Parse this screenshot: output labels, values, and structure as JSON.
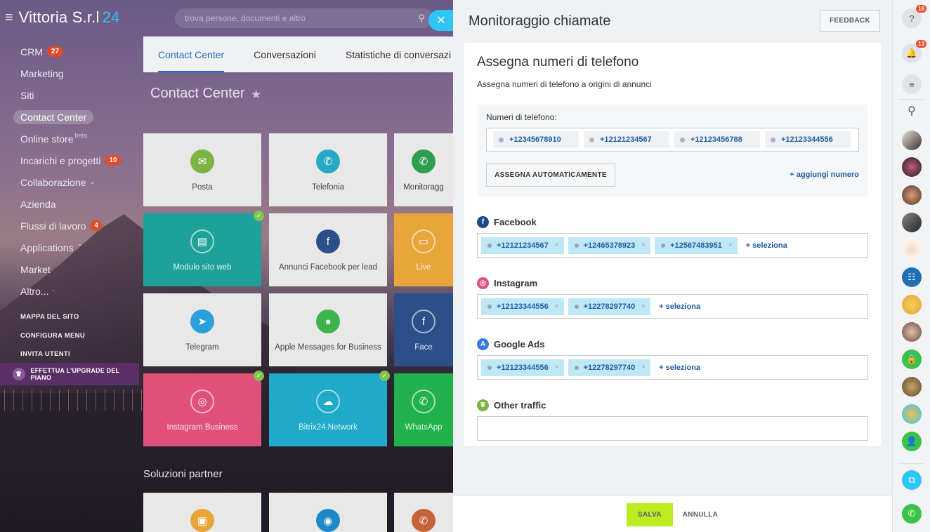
{
  "app": {
    "logo": "Vittoria S.r.l",
    "logo_num": "24",
    "search_placeholder": "trova persone, documenti e altro"
  },
  "menu": {
    "items": [
      {
        "label": "CRM",
        "badge": "27"
      },
      {
        "label": "Marketing"
      },
      {
        "label": "Siti"
      },
      {
        "label": "Contact Center",
        "active": true
      },
      {
        "label": "Online store",
        "sup": "beta"
      },
      {
        "label": "Incarichi e progetti",
        "badge": "10"
      },
      {
        "label": "Collaborazione",
        "chevron": "down"
      },
      {
        "label": "Azienda"
      },
      {
        "label": "Flussi di lavoro",
        "badge": "4"
      },
      {
        "label": "Applications",
        "chevron": "up"
      },
      {
        "label": "Market"
      },
      {
        "label": "Altro...",
        "chevron": "-"
      }
    ],
    "links": [
      "MAPPA DEL SITO",
      "CONFIGURA MENU",
      "INVITA UTENTI"
    ],
    "upgrade": "EFFETTUA L'UPGRADE DEL PIANO"
  },
  "contact_center": {
    "tabs": [
      "Contact Center",
      "Conversazioni",
      "Statistiche di conversazi"
    ],
    "title": "Contact Center",
    "tiles": [
      {
        "label": "Posta",
        "icon": "mail-icon",
        "color": "#7cb342"
      },
      {
        "label": "Telefonia",
        "icon": "phone-icon",
        "color": "#26a9c4"
      },
      {
        "label": "Monitoragg",
        "icon": "call-tracking-icon",
        "color": "#2e9e4f"
      },
      {
        "label": "Modulo sito web",
        "icon": "form-icon",
        "color": "#1ea198",
        "checked": true
      },
      {
        "label": "Annunci Facebook per lead",
        "icon": "facebook-leads-icon",
        "color": "#2c4f8a"
      },
      {
        "label": "Live",
        "icon": "chat-icon",
        "color": "#e8a53a"
      },
      {
        "label": "Telegram",
        "icon": "telegram-icon",
        "color": "#2aa0db"
      },
      {
        "label": "Apple Messages for Business",
        "icon": "apple-messages-icon",
        "color": "#3cb44a"
      },
      {
        "label": "Face",
        "icon": "facebook-icon",
        "color": "#2c4f8a"
      },
      {
        "label": "Instagram Business",
        "icon": "instagram-icon",
        "color": "#e0507a",
        "checked": true
      },
      {
        "label": "Bitrix24.Network",
        "icon": "cloud-icon",
        "color": "#1eaac8",
        "checked": true
      },
      {
        "label": "WhatsApp",
        "icon": "whatsapp-icon",
        "color": "#22b24c"
      }
    ],
    "partner_title": "Soluzioni partner"
  },
  "panel": {
    "title": "Monitoraggio chiamate",
    "feedback": "FEEDBACK",
    "card_title": "Assegna numeri di telefono",
    "card_subtitle": "Assegna numeri di telefono a origini di annunci",
    "numbers_label": "Numeri di telefono:",
    "numbers": [
      "+12345678910",
      "+12121234567",
      "+12123456788",
      "+12123344556"
    ],
    "auto_assign": "ASSEGNA AUTOMATICAMENTE",
    "add_number": "+ aggiungi numero",
    "sources": [
      {
        "name": "Facebook",
        "icon": "facebook-icon",
        "color": "#1f4a8a",
        "numbers": [
          "+12121234567",
          "+12465378923",
          "+12567483951"
        ],
        "select": "+  seleziona"
      },
      {
        "name": "Instagram",
        "icon": "instagram-icon",
        "color": "#e0507a",
        "numbers": [
          "+12123344556",
          "+12278297740"
        ],
        "select": "+  seleziona"
      },
      {
        "name": "Google Ads",
        "icon": "google-ads-icon",
        "color": "#3a7ad9",
        "numbers": [
          "+12123344556",
          "+12278297740"
        ],
        "select": "+  seleziona"
      },
      {
        "name": "Other traffic",
        "icon": "leaf-icon",
        "color": "#7cb342",
        "numbers": [],
        "select": ""
      }
    ],
    "save": "SALVA",
    "cancel": "ANNULLA"
  },
  "rail": {
    "help_badge": "16",
    "notif_badge": "13"
  }
}
